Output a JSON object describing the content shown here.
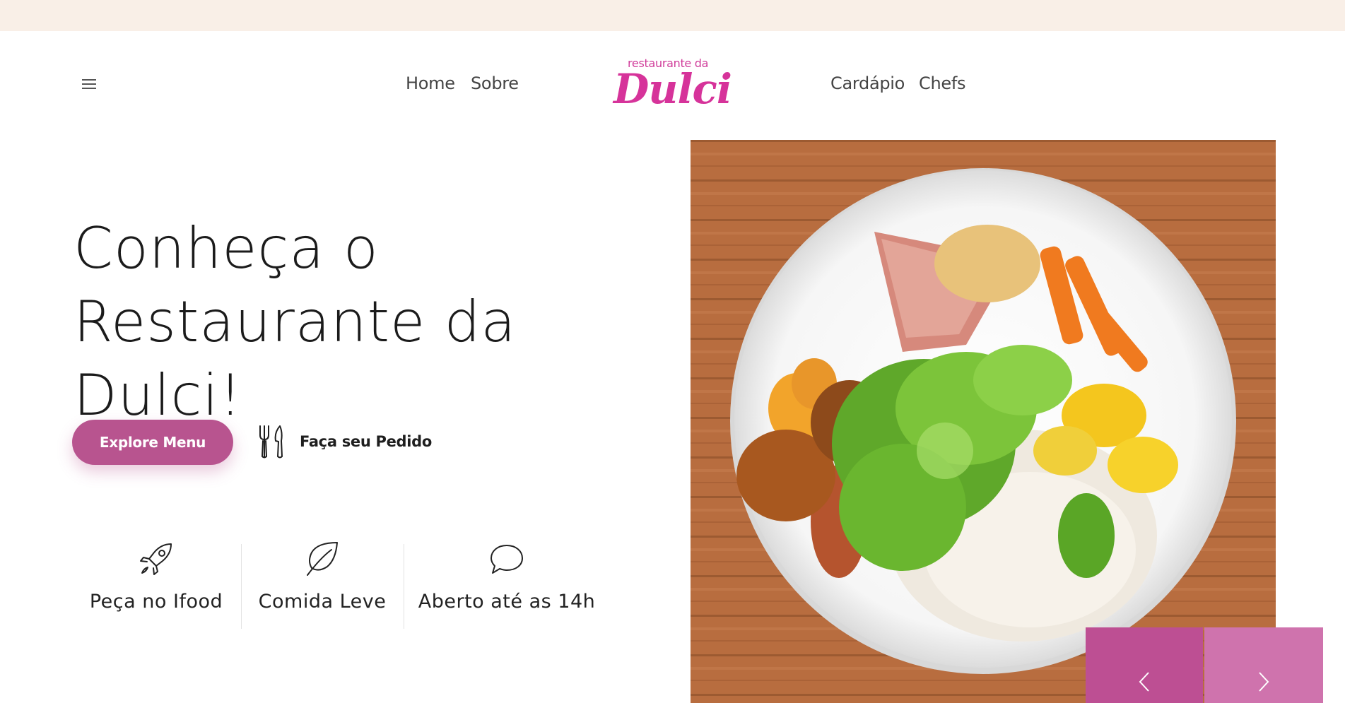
{
  "nav": {
    "left": [
      {
        "label": "Home"
      },
      {
        "label": "Sobre"
      }
    ],
    "right": [
      {
        "label": "Cardápio"
      },
      {
        "label": "Chefs"
      }
    ],
    "logo": {
      "small": "restaurante da",
      "main": "Dulci"
    }
  },
  "hero": {
    "title_line1": "Conheça o",
    "title_line2": "Restaurante da Dulci!",
    "explore_button": "Explore Menu",
    "order_link": "Faça seu Pedido"
  },
  "features": [
    {
      "icon": "rocket-icon",
      "label": "Peça no Ifood"
    },
    {
      "icon": "leaf-icon",
      "label": "Comida Leve"
    },
    {
      "icon": "chat-bubble-icon",
      "label": "Aberto até as 14h"
    }
  ],
  "colors": {
    "topbar": "#f9efe7",
    "accent": "#b8548f",
    "logo": "#d6339a",
    "slider_prev": "#bd4f93",
    "slider_next": "#cf73ad"
  }
}
